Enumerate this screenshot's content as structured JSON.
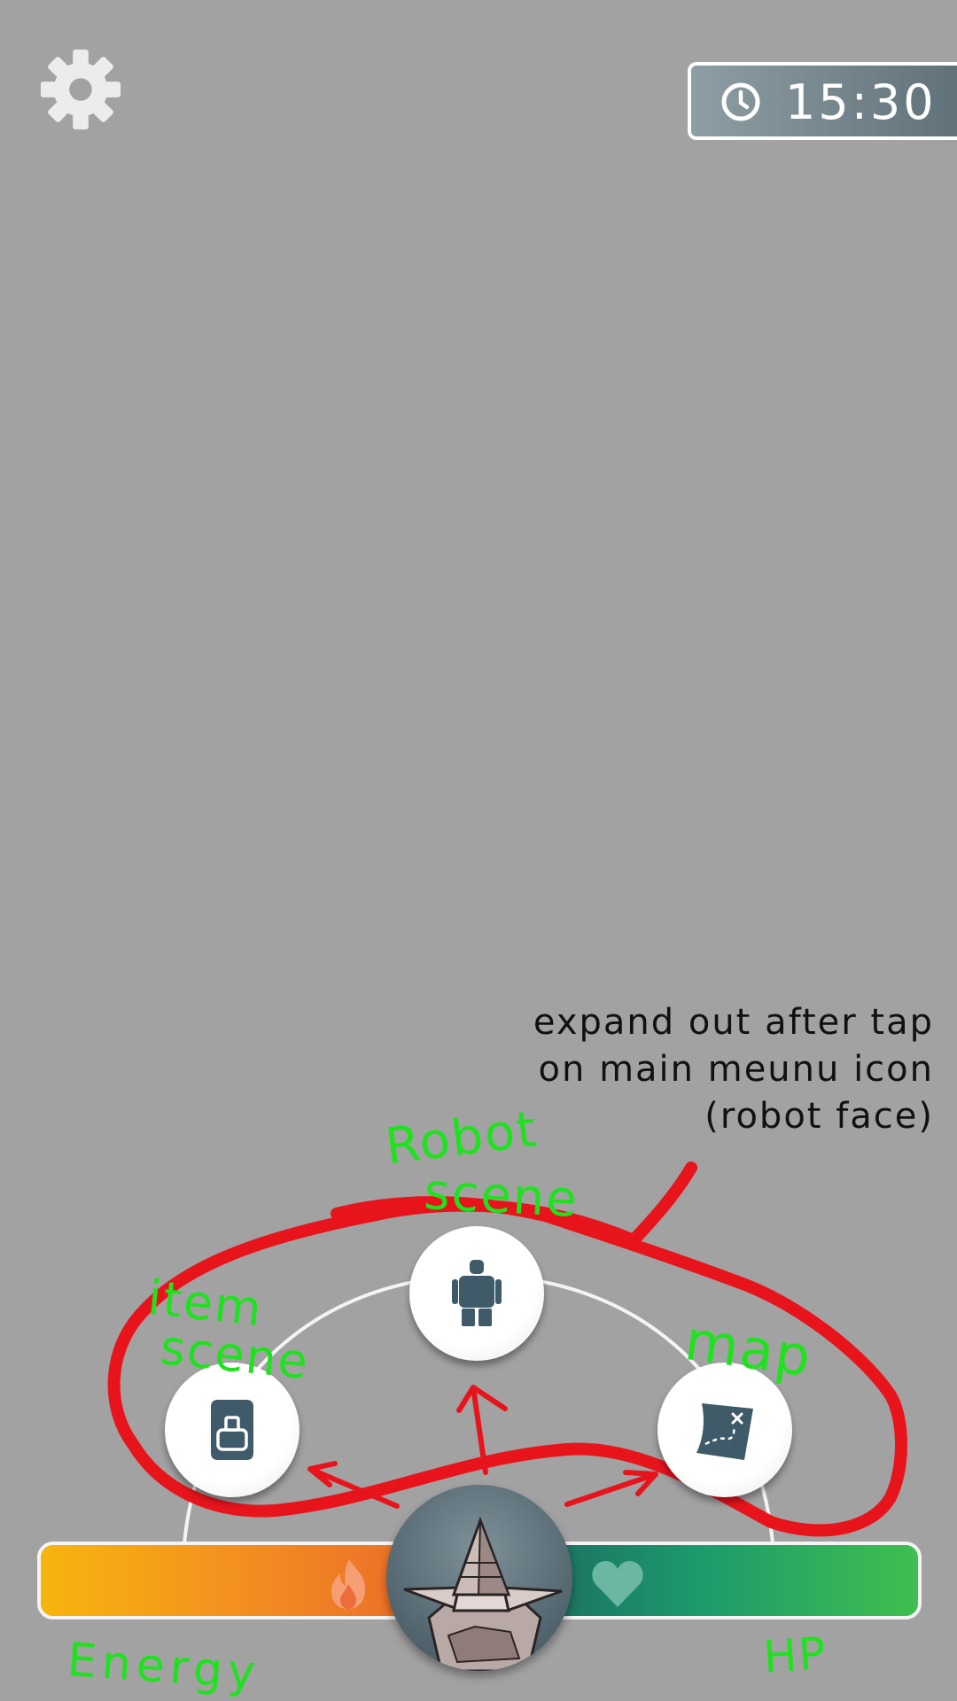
{
  "hud": {
    "timer": "15:30",
    "settings_icon": "gear-icon",
    "timer_icon": "clock-icon"
  },
  "annotation": {
    "lines": [
      "expand out after tap",
      "on main meunu icon",
      "(robot face)"
    ]
  },
  "menu": {
    "items": [
      {
        "icon": "robot-icon",
        "handwritten_label": [
          "Robot",
          "scene"
        ]
      },
      {
        "icon": "backpack-icon",
        "handwritten_label": [
          "item",
          "scene"
        ]
      },
      {
        "icon": "map-icon",
        "handwritten_label": [
          "map"
        ]
      }
    ],
    "main_icon": "robot-face-icon"
  },
  "status": {
    "energy_label": "Energy",
    "hp_label": "HP",
    "energy_icon": "fire-icon",
    "hp_icon": "heart-icon"
  },
  "colors": {
    "background": "#a2a2a2",
    "button_icon": "#3f5a68",
    "annotation_green": "#1fe21f",
    "annotation_red": "#e8141c",
    "energy_start": "#f7b50e",
    "energy_end": "#e8612c",
    "hp_start": "#1d5f5e",
    "hp_end": "#3fbf4e"
  }
}
